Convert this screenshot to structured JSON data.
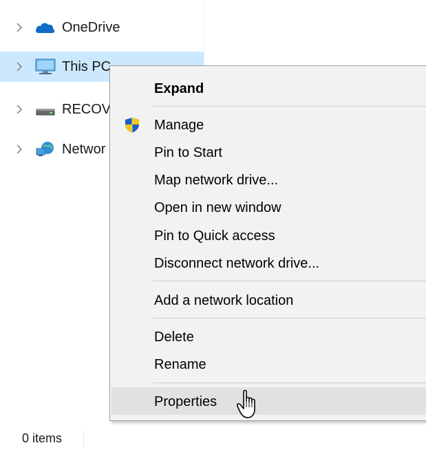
{
  "nav": {
    "items": [
      {
        "label": "OneDrive",
        "icon": "onedrive-cloud-icon",
        "expanded": false,
        "selected": false
      },
      {
        "label": "This PC",
        "icon": "computer-monitor-icon",
        "expanded": false,
        "selected": true
      },
      {
        "label": "RECOV",
        "icon": "drive-icon",
        "expanded": false,
        "selected": false
      },
      {
        "label": "Networ",
        "icon": "network-icon",
        "expanded": false,
        "selected": false
      }
    ]
  },
  "context_menu": {
    "items": [
      {
        "label": "Expand",
        "bold": true
      },
      {
        "label": "Manage",
        "icon": "uac-shield-icon"
      },
      {
        "label": "Pin to Start"
      },
      {
        "label": "Map network drive..."
      },
      {
        "label": "Open in new window"
      },
      {
        "label": "Pin to Quick access"
      },
      {
        "label": "Disconnect network drive..."
      },
      {
        "label": "Add a network location"
      },
      {
        "label": "Delete"
      },
      {
        "label": "Rename"
      },
      {
        "label": "Properties",
        "highlighted": true
      }
    ]
  },
  "status_bar": {
    "item_count": "0 items"
  },
  "colors": {
    "selection": "#cce8ff",
    "menu_background": "#f2f2f2",
    "menu_hover": "#e1e1e1",
    "menu_border": "#a0a0a0"
  },
  "cursor": {
    "icon": "hand-pointer-icon"
  }
}
